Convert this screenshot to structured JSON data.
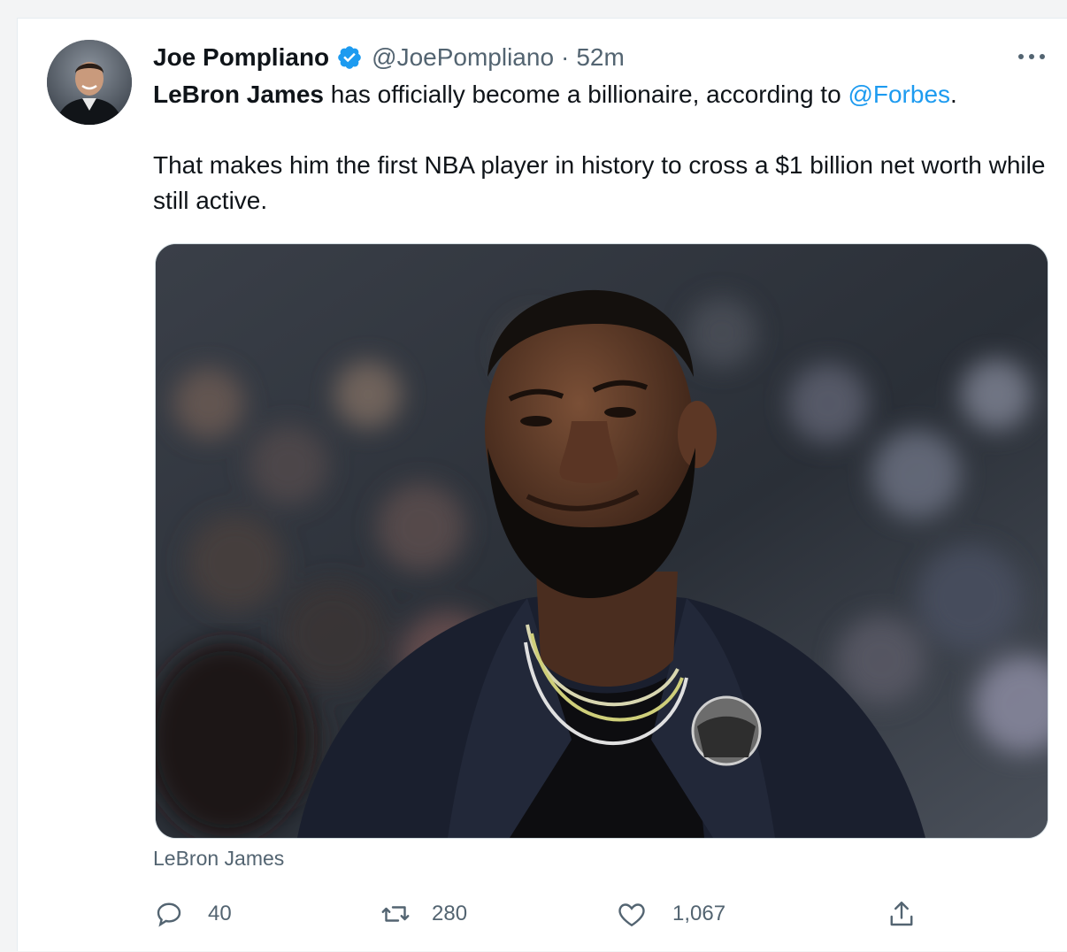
{
  "tweet": {
    "author_name": "Joe Pompliano",
    "handle": "@JoePompliano",
    "separator": "·",
    "time": "52m",
    "text_bold_name": "LeBron James",
    "text_part1": " has officially become a billionaire, according to ",
    "text_mention": "@Forbes",
    "text_period": ".",
    "text_para2": "That makes him the first NBA player in history to cross a $1 billion net worth while still active.",
    "media_caption": "LeBron James"
  },
  "actions": {
    "reply_count": "40",
    "retweet_count": "280",
    "like_count": "1,067"
  },
  "icons": {
    "verified": "verified-badge-icon",
    "more": "more-dots-icon",
    "reply": "reply-icon",
    "retweet": "retweet-icon",
    "like": "heart-icon",
    "share": "share-icon"
  },
  "colors": {
    "link": "#1d9bf0",
    "verified": "#1d9bf0",
    "secondary_text": "#536471",
    "primary_text": "#0f1419"
  }
}
